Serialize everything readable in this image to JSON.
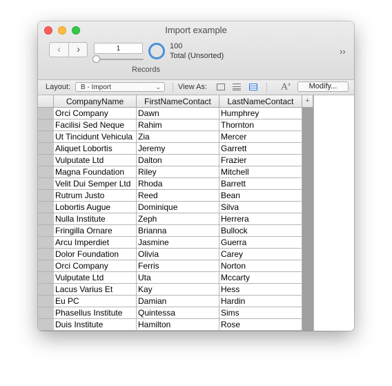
{
  "window": {
    "title": "Import example"
  },
  "toolbar": {
    "record_number": "1",
    "records_label": "Records",
    "total_count": "100",
    "total_state": "Total (Unsorted)",
    "nav_prev_icon": "chevron-left-icon",
    "nav_next_icon": "chevron-right-icon",
    "overflow_label": "››"
  },
  "layoutbar": {
    "layout_label": "Layout:",
    "layout_value": "B - Import",
    "view_as_label": "View As:",
    "font_icon_text": "A",
    "font_icon_sup": "a",
    "modify_label": "Modify..."
  },
  "table": {
    "columns": [
      "CompanyName",
      "FirstNameContact",
      "LastNameContact"
    ],
    "add_column_label": "+",
    "rows": [
      [
        "Orci Company",
        "Dawn",
        "Humphrey"
      ],
      [
        "Facilisi Sed Neque",
        "Rahim",
        "Thornton"
      ],
      [
        "Ut Tincidunt Vehicula",
        "Zia",
        "Mercer"
      ],
      [
        "Aliquet Lobortis",
        "Jeremy",
        "Garrett"
      ],
      [
        "Vulputate Ltd",
        "Dalton",
        "Frazier"
      ],
      [
        "Magna Foundation",
        "Riley",
        "Mitchell"
      ],
      [
        "Velit Dui Semper Ltd",
        "Rhoda",
        "Barrett"
      ],
      [
        "Rutrum Justo",
        "Reed",
        "Bean"
      ],
      [
        "Lobortis Augue",
        "Dominique",
        "Silva"
      ],
      [
        "Nulla Institute",
        "Zeph",
        "Herrera"
      ],
      [
        "Fringilla Ornare",
        "Brianna",
        "Bullock"
      ],
      [
        "Arcu Imperdiet",
        "Jasmine",
        "Guerra"
      ],
      [
        "Dolor Foundation",
        "Olivia",
        "Carey"
      ],
      [
        "Orci Company",
        "Ferris",
        "Norton"
      ],
      [
        "Vulputate Ltd",
        "Uta",
        "Mccarty"
      ],
      [
        "Lacus Varius Et",
        "Kay",
        "Hess"
      ],
      [
        "Eu PC",
        "Damian",
        "Hardin"
      ],
      [
        "Phasellus Institute",
        "Quintessa",
        "Sims"
      ],
      [
        "Duis Institute",
        "Hamilton",
        "Rose"
      ]
    ]
  },
  "colors": {
    "close": "#fc605c",
    "minimize": "#fdbc40",
    "maximize": "#34c84a",
    "accent": "#4a90d9"
  }
}
